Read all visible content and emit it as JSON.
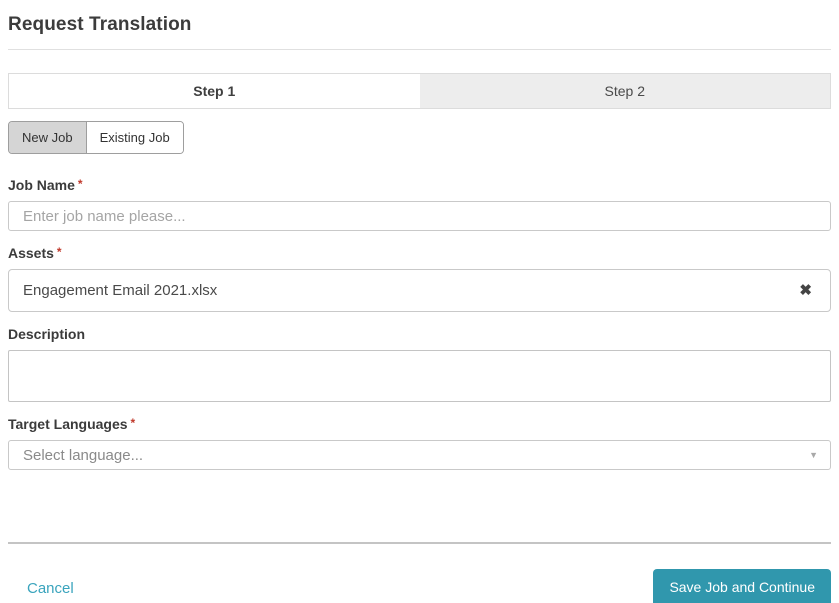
{
  "page": {
    "title": "Request Translation"
  },
  "steps": [
    {
      "label": "Step 1",
      "active": true
    },
    {
      "label": "Step 2",
      "active": false
    }
  ],
  "tabs": [
    {
      "label": "New Job",
      "selected": true
    },
    {
      "label": "Existing Job",
      "selected": false
    }
  ],
  "form": {
    "job_name": {
      "label": "Job Name",
      "required_marker": "*",
      "value": "",
      "placeholder": "Enter job name please..."
    },
    "assets": {
      "label": "Assets",
      "required_marker": "*",
      "value": "Engagement Email 2021.xlsx",
      "remove_icon_glyph": "✖"
    },
    "description": {
      "label": "Description",
      "value": ""
    },
    "target_languages": {
      "label": "Target Languages",
      "required_marker": "*",
      "placeholder": "Select language...",
      "caret_glyph": "▼"
    }
  },
  "footer": {
    "cancel_label": "Cancel",
    "save_label": "Save Job and Continue"
  },
  "colors": {
    "accent_teal": "#3097ad",
    "link_teal": "#3aa4bd",
    "required_red": "#c0392b",
    "step_inactive_bg": "#ededed",
    "tab_selected_bg": "#d5d5d5"
  }
}
